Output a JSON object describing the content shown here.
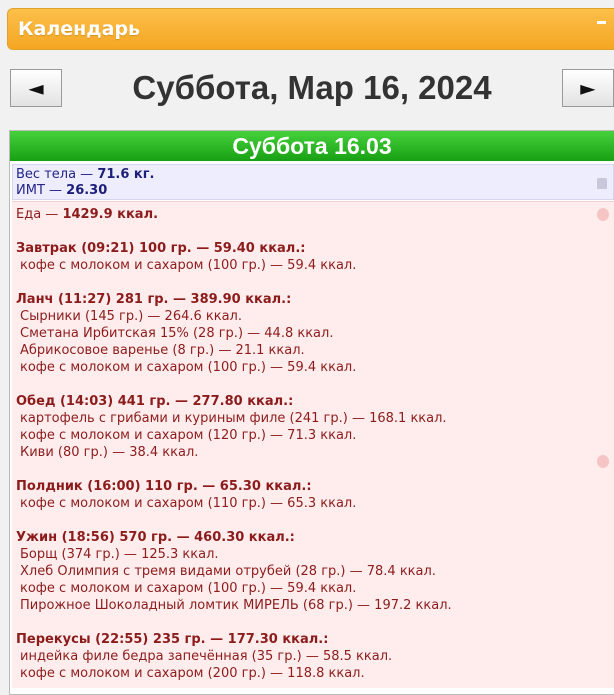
{
  "panel": {
    "title": "Календарь",
    "collapse_icon": "minimize-icon"
  },
  "nav": {
    "prev_label": "◄",
    "next_label": "►",
    "date_title": "Суббота, Мар 16, 2024"
  },
  "day": {
    "header": "Суббота 16.03",
    "weight_label": "Вес тела —",
    "weight_value": "71.6 кг.",
    "bmi_label": "ИМТ —",
    "bmi_value": "26.30",
    "food_label": "Еда —",
    "food_total": "1429.9 ккал.",
    "meals": [
      {
        "title": "Завтрак (09:21) 100 гр. — 59.40 ккал.:",
        "items": [
          "кофе с молоком и сахаром (100 гр.) — 59.4 ккал."
        ]
      },
      {
        "title": "Ланч (11:27) 281 гр. — 389.90 ккал.:",
        "items": [
          "Сырники (145 гр.) — 264.6 ккал.",
          "Сметана Ирбитская 15% (28 гр.) — 44.8 ккал.",
          "Абрикосовое варенье (8 гр.) — 21.1 ккал.",
          "кофе с молоком и сахаром (100 гр.) — 59.4 ккал."
        ]
      },
      {
        "title": "Обед (14:03) 441 гр. — 277.80 ккал.:",
        "items": [
          "картофель с грибами и куриным филе (241 гр.) — 168.1 ккал.",
          "кофе с молоком и сахаром (120 гр.) — 71.3 ккал.",
          "Киви (80 гр.) — 38.4 ккал."
        ]
      },
      {
        "title": "Полдник (16:00) 110 гр. — 65.30 ккал.:",
        "items": [
          "кофе с молоком и сахаром (110 гр.) — 65.3 ккал."
        ]
      },
      {
        "title": "Ужин (18:56) 570 гр. — 460.30 ккал.:",
        "items": [
          "Борщ (374 гр.) — 125.3 ккал.",
          "Хлеб Олимпия с тремя видами отрубей (28 гр.) — 78.4 ккал.",
          "кофе с молоком и сахаром (100 гр.) — 59.4 ккал.",
          "Пирожное Шоколадный ломтик МИРЕЛЬ (68 гр.) — 197.2 ккал."
        ]
      },
      {
        "title": "Перекусы (22:55) 235 гр. — 177.30 ккал.:",
        "items": [
          "индейка филе бедра запечённая (35 гр.) — 58.5 ккал.",
          "кофе с молоком и сахаром (200 гр.) — 118.8 ккал."
        ]
      }
    ]
  },
  "colors": {
    "header_orange": "#f5a623",
    "day_green": "#18a014",
    "weight_bg": "#ededfe",
    "food_bg": "#ffeded",
    "food_text": "#8c1c1c"
  }
}
